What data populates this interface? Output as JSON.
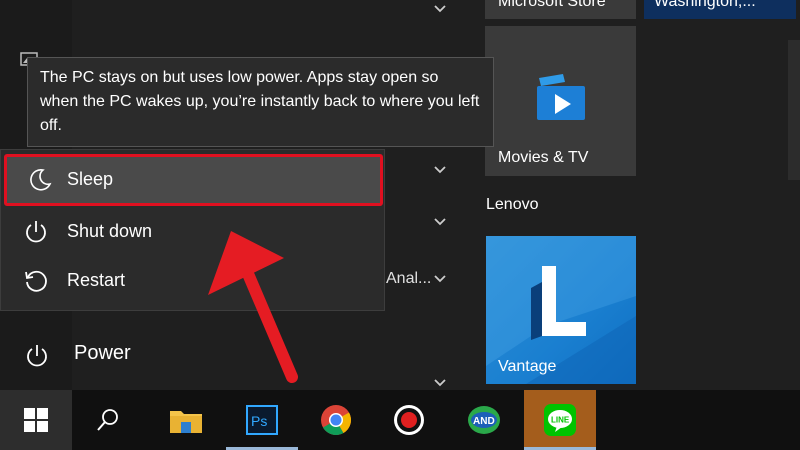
{
  "tooltip": {
    "text": "The PC stays on but uses low power. Apps stay open so when the PC wakes up, you’re instantly back to where you left off."
  },
  "power_menu": {
    "items": [
      {
        "label": "Sleep",
        "icon": "moon-icon",
        "highlighted": true
      },
      {
        "label": "Shut down",
        "icon": "power-icon"
      },
      {
        "label": "Restart",
        "icon": "restart-icon"
      }
    ]
  },
  "left_rail": {
    "power_label": "Power"
  },
  "app_list": {
    "truncated_item": "Anal..."
  },
  "tiles": {
    "store": "Microsoft Store",
    "weather": "Washington,...",
    "movies": "Movies & TV",
    "group": "Lenovo",
    "vantage": "Vantage"
  },
  "taskbar": {
    "items": [
      "windows-start-icon",
      "search-icon",
      "file-explorer-icon",
      "photoshop-icon",
      "chrome-icon",
      "record-icon",
      "and-icon",
      "line-icon"
    ]
  },
  "colors": {
    "highlight_border": "#e01020",
    "arrow": "#e51c23",
    "vantage_tile": "#1a7fd0",
    "line_tile": "#a45d1c"
  }
}
